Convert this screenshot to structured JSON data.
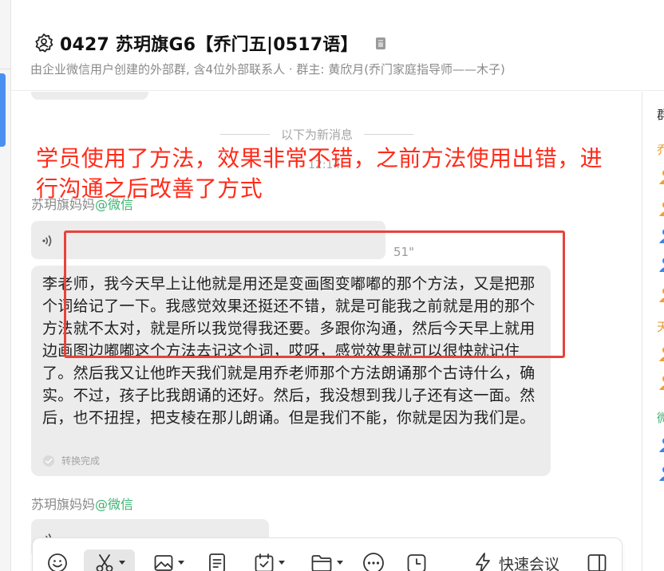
{
  "header": {
    "title": "0427 苏玥旗G6【乔门五|0517语】",
    "subtitle": "由企业微信用户创建的外部群, 含4位外部联系人 · 群主: 黄欣月(乔门家庭指导师——木子)"
  },
  "chat": {
    "new_messages_divider": "以下为新消息",
    "time": "12:14",
    "messages": [
      {
        "sender": "苏玥旗妈妈",
        "source": "@微信",
        "type": "voice",
        "duration": "51\"",
        "transcript": "李老师，我今天早上让他就是用还是变画图变嘟嘟的那个方法，又是把那个词给记了一下。我感觉效果还挺还不错，就是可能我之前就是用的那个方法就不太对，就是所以我觉得我还要。多跟你沟通，然后今天早上就用边画图边嘟嘟这个方法去记这个词，哎呀，感觉效果就可以很快就记住了。然后我又让他昨天我们就是用乔老师那个方法朗诵那个古诗什么，确实。不过，孩子比我朗诵的还好。然后，我没想到我儿子还有这一面。然后，也不扭捏，把支棱在那儿朗诵。但是我们不能，你就是因为我们是。",
        "transcript_status": "转换完成"
      },
      {
        "sender": "苏玥旗妈妈",
        "source": "@微信",
        "type": "voice"
      }
    ]
  },
  "annotation": {
    "text_line1": "学员使用了方法，效果非常不错，之前方法使用出错，进",
    "text_line2": "行沟通之后改善了方式",
    "color": "#ff2b1a"
  },
  "toolbar": {
    "items": [
      {
        "icon": "emoji-icon"
      },
      {
        "icon": "scissors-icon",
        "has_dropdown": true,
        "active": true
      },
      {
        "icon": "image-icon",
        "has_dropdown": true
      },
      {
        "icon": "document-icon"
      },
      {
        "icon": "calendar-check-icon",
        "has_dropdown": true
      },
      {
        "icon": "folder-icon",
        "has_dropdown": true
      },
      {
        "icon": "more-icon"
      },
      {
        "icon": "clock-icon"
      }
    ],
    "quick_meeting_label": "快速会议"
  },
  "right_panel": {
    "label_fragments": [
      "群",
      "乔",
      "天",
      "微"
    ]
  },
  "colors": {
    "accent": "#4a90f0",
    "wechat_green": "#3cb371",
    "bubble": "#ececec",
    "annotation_red": "#e8423b"
  }
}
